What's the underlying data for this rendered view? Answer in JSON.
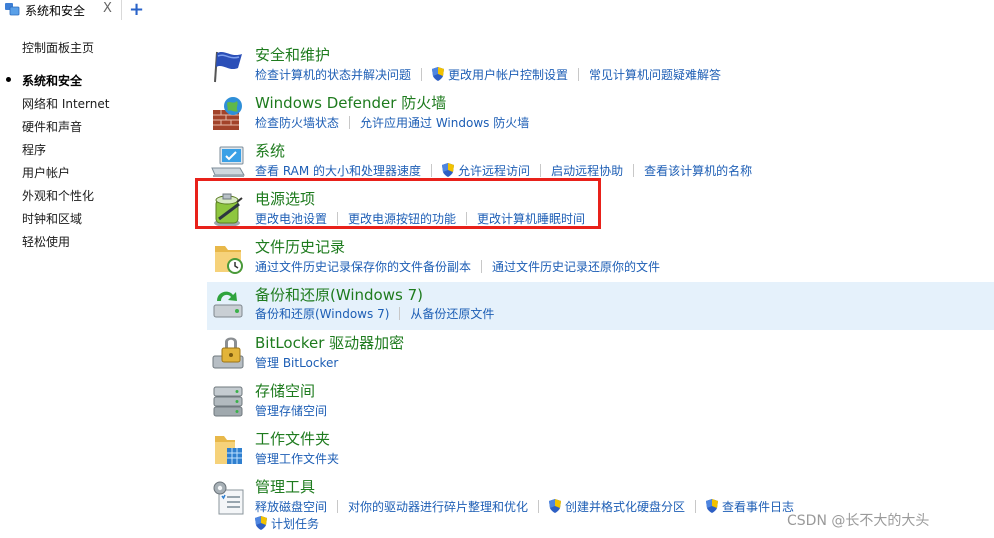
{
  "tab": {
    "title": "系统和安全",
    "close": "X",
    "add": "+"
  },
  "nav": {
    "home": "控制面板主页",
    "items": [
      "系统和安全",
      "网络和 Internet",
      "硬件和声音",
      "程序",
      "用户帐户",
      "外观和个性化",
      "时钟和区域",
      "轻松使用"
    ],
    "active_index": 0
  },
  "categories": [
    {
      "title": "安全和维护",
      "icon": "flag-icon",
      "links": [
        {
          "label": "检查计算机的状态并解决问题",
          "shield": false
        },
        {
          "label": "更改用户帐户控制设置",
          "shield": true
        },
        {
          "label": "常见计算机问题疑难解答",
          "shield": false
        }
      ]
    },
    {
      "title": "Windows Defender 防火墙",
      "icon": "firewall-icon",
      "links": [
        {
          "label": "检查防火墙状态",
          "shield": false
        },
        {
          "label": "允许应用通过 Windows 防火墙",
          "shield": false
        }
      ]
    },
    {
      "title": "系统",
      "icon": "computer-icon",
      "links": [
        {
          "label": "查看 RAM 的大小和处理器速度",
          "shield": false
        },
        {
          "label": "允许远程访问",
          "shield": true
        },
        {
          "label": "启动远程协助",
          "shield": false
        },
        {
          "label": "查看该计算机的名称",
          "shield": false
        }
      ]
    },
    {
      "title": "电源选项",
      "icon": "battery-icon",
      "links": [
        {
          "label": "更改电池设置",
          "shield": false
        },
        {
          "label": "更改电源按钮的功能",
          "shield": false
        },
        {
          "label": "更改计算机睡眠时间",
          "shield": false
        }
      ]
    },
    {
      "title": "文件历史记录",
      "icon": "file-history-icon",
      "links": [
        {
          "label": "通过文件历史记录保存你的文件备份副本",
          "shield": false
        },
        {
          "label": "通过文件历史记录还原你的文件",
          "shield": false
        }
      ]
    },
    {
      "title": "备份和还原(Windows 7)",
      "icon": "backup-icon",
      "links": [
        {
          "label": "备份和还原(Windows 7)",
          "shield": false
        },
        {
          "label": "从备份还原文件",
          "shield": false
        }
      ]
    },
    {
      "title": "BitLocker 驱动器加密",
      "icon": "bitlocker-icon",
      "links": [
        {
          "label": "管理 BitLocker",
          "shield": false
        }
      ]
    },
    {
      "title": "存储空间",
      "icon": "storage-icon",
      "links": [
        {
          "label": "管理存储空间",
          "shield": false
        }
      ]
    },
    {
      "title": "工作文件夹",
      "icon": "work-folder-icon",
      "links": [
        {
          "label": "管理工作文件夹",
          "shield": false
        }
      ]
    },
    {
      "title": "管理工具",
      "icon": "admin-tools-icon",
      "links": [
        {
          "label": "释放磁盘空间",
          "shield": false
        },
        {
          "label": "对你的驱动器进行碎片整理和优化",
          "shield": false
        },
        {
          "label": "创建并格式化硬盘分区",
          "shield": true
        },
        {
          "label": "查看事件日志",
          "shield": true
        }
      ],
      "links2": [
        {
          "label": "计划任务",
          "shield": true
        }
      ]
    }
  ],
  "watermark": "CSDN @长不大的大头",
  "colors": {
    "title": "#1e7b1e",
    "link": "#1d5eb5",
    "highlight": "#e8211a",
    "hover": "#e5f1fb"
  }
}
